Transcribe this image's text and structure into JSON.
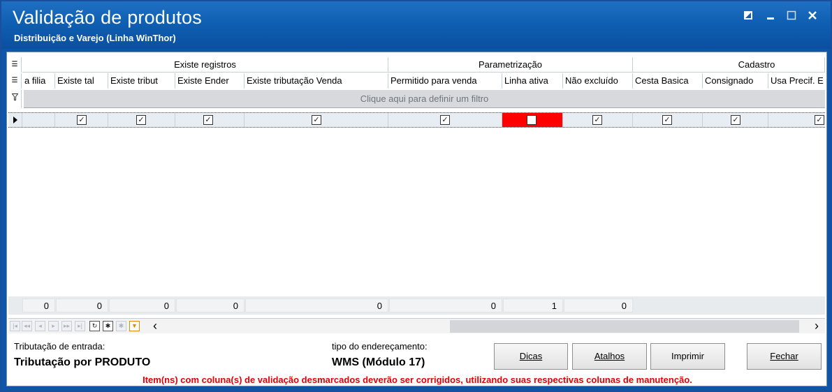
{
  "window": {
    "title": "Validação de produtos",
    "subtitle": "Distribuição e Varejo (Linha WinThor)",
    "controls": [
      "restore-icon",
      "minimize-icon",
      "maximize-icon",
      "close-icon"
    ]
  },
  "grid": {
    "groups": [
      "Existe registros",
      "Parametrização",
      "Cadastro"
    ],
    "columns": [
      "a filia",
      "Existe tal",
      "Existe tribut",
      "Existe Ender",
      "Existe tributação Venda",
      "Permitido para venda",
      "Linha ativa",
      "Não excluído",
      "Cesta Basica",
      "Consignado",
      "Usa Precif. E"
    ],
    "filter_placeholder": "Clique aqui para definir um filtro",
    "row": {
      "checked": [
        true,
        true,
        true,
        true,
        true,
        true,
        false,
        true,
        true,
        true,
        true
      ],
      "invalid_color": "#ff0000"
    },
    "totals": [
      "0",
      "0",
      "0",
      "0",
      "0",
      "0",
      "1",
      "0"
    ]
  },
  "navigator": {
    "buttons": [
      "first-icon",
      "prev-page-icon",
      "prev-icon",
      "next-icon",
      "next-page-icon",
      "last-icon",
      "refresh-icon",
      "insert-icon",
      "delete-icon",
      "filter-icon"
    ],
    "scroll_left": "‹",
    "scroll_right": "›"
  },
  "footer": {
    "tributacao_label": "Tributação de entrada:",
    "tributacao_value": "Tributação por PRODUTO",
    "endereco_label": "tipo do endereçamento:",
    "endereco_value": "WMS (Módulo 17)",
    "buttons": {
      "dicas": "Dicas",
      "atalhos": "Atalhos",
      "imprimir": "Imprimir",
      "fechar": "Fechar"
    },
    "warning": "Item(ns) com coluna(s) de validação desmarcados deverão ser corrigidos, utilizando suas respectivas colunas de manutenção."
  }
}
